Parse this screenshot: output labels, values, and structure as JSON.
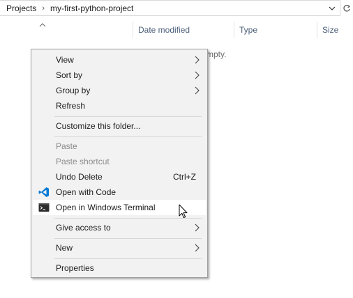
{
  "address": {
    "crumbs": [
      "Projects",
      "my-first-python-project"
    ],
    "separator": "›"
  },
  "columns": {
    "date_modified": "Date modified",
    "type": "Type",
    "size": "Size"
  },
  "empty_message_fragment": "mpty.",
  "menu": {
    "view": "View",
    "sort_by": "Sort by",
    "group_by": "Group by",
    "refresh": "Refresh",
    "customize": "Customize this folder...",
    "paste": "Paste",
    "paste_shortcut": "Paste shortcut",
    "undo_delete": "Undo Delete",
    "undo_shortcut": "Ctrl+Z",
    "open_with_code": "Open with Code",
    "open_terminal": "Open in Windows Terminal",
    "give_access": "Give access to",
    "new": "New",
    "properties": "Properties"
  },
  "colors": {
    "vscode_blue": "#0078d4",
    "terminal_dark": "#2d2d2d",
    "header_text": "#4c607a"
  },
  "icons": [
    "chevron-down-icon",
    "refresh-icon",
    "sort-up-icon",
    "vscode-icon",
    "terminal-icon",
    "submenu-arrow-icon",
    "mouse-cursor-icon"
  ]
}
